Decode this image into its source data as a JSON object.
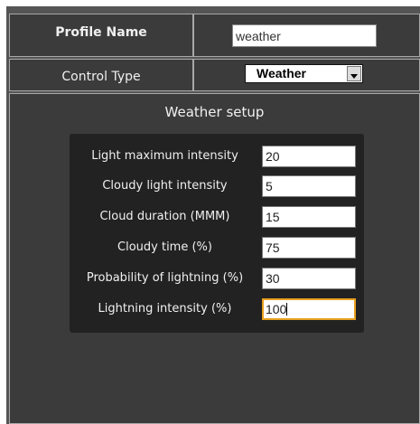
{
  "profile": {
    "label": "Profile Name",
    "value": "weather"
  },
  "control": {
    "label": "Control Type",
    "selected": "Weather"
  },
  "setup": {
    "title": "Weather setup",
    "fields": [
      {
        "label": "Light maximum intensity",
        "value": "20"
      },
      {
        "label": "Cloudy light intensity",
        "value": "5"
      },
      {
        "label": "Cloud duration (MMM)",
        "value": "15"
      },
      {
        "label": "Cloudy time (%)",
        "value": "75"
      },
      {
        "label": "Probability of lightning (%)",
        "value": "30"
      },
      {
        "label": "Lightning intensity (%)",
        "value": "100"
      }
    ]
  },
  "colors": {
    "background": "#3b3b3b",
    "setup_box": "#222222",
    "focus_border": "#e8a020"
  }
}
